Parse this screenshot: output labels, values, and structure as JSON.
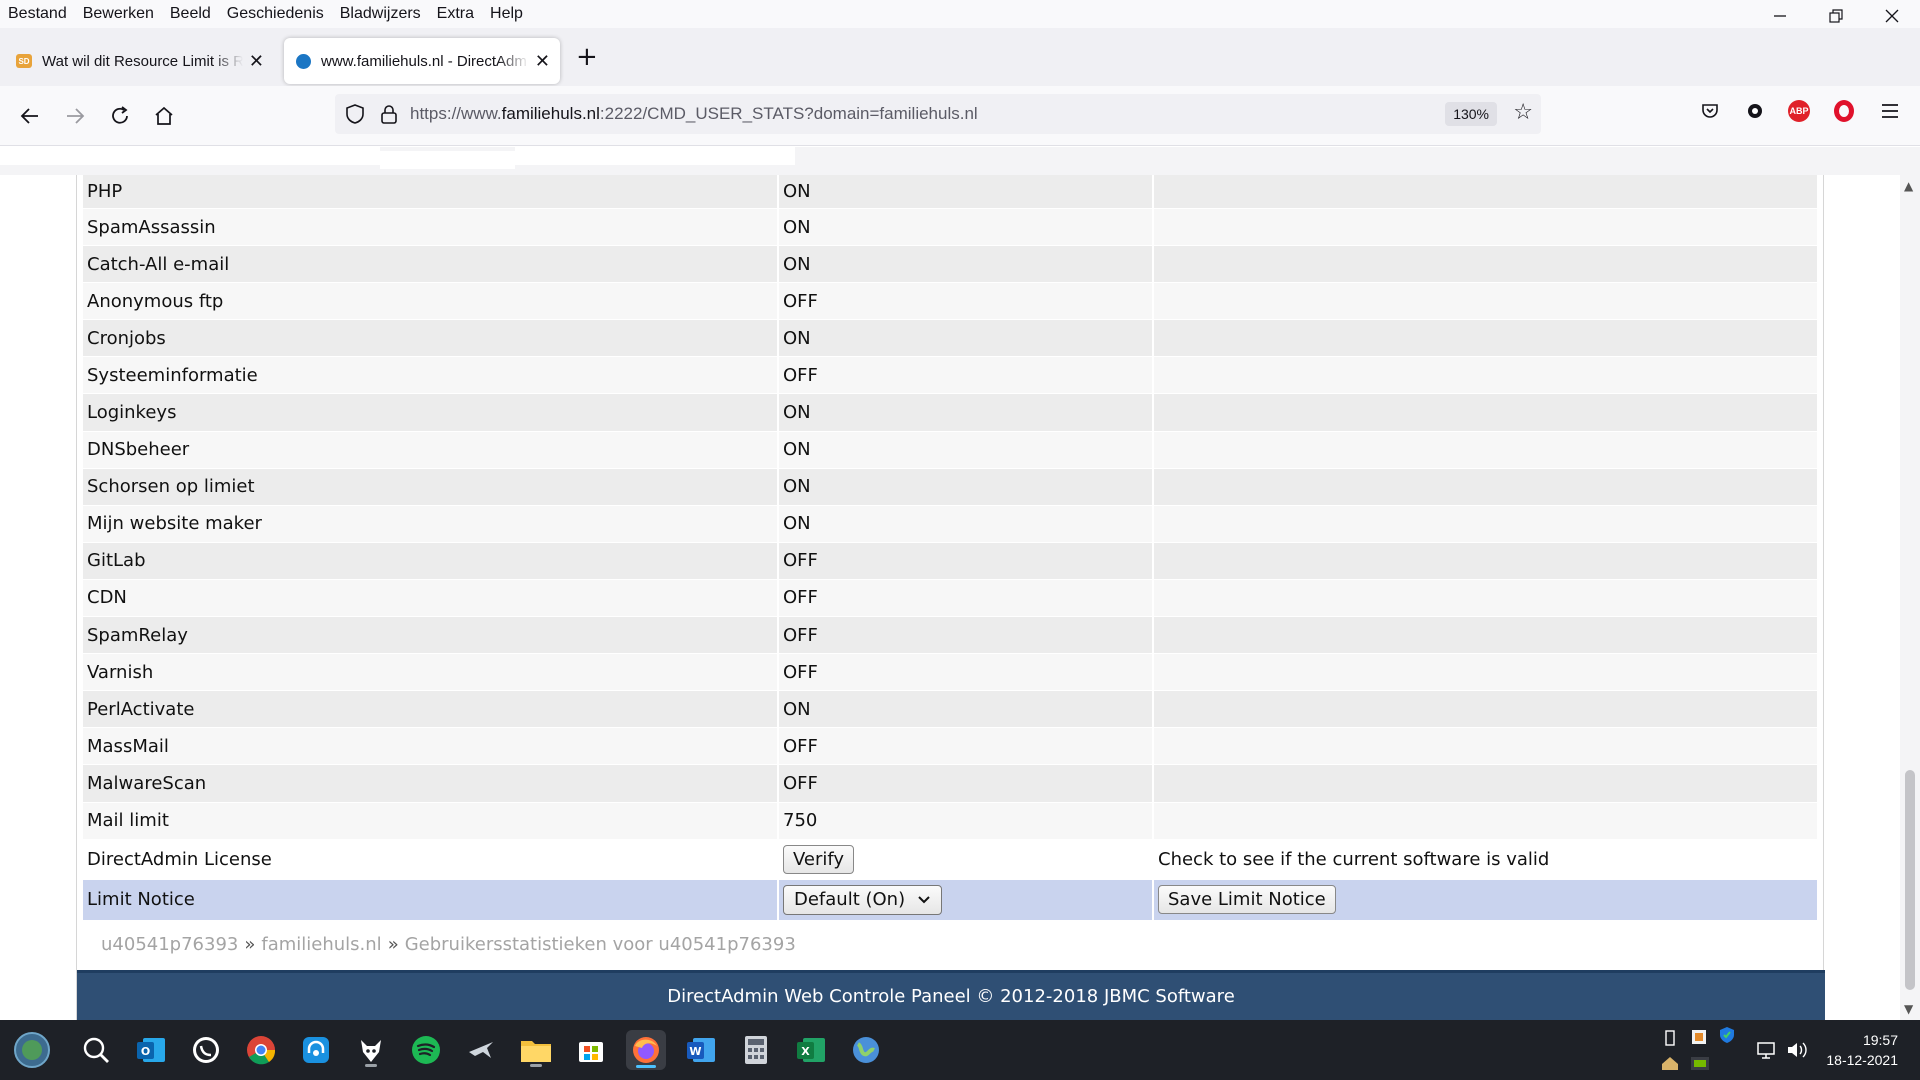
{
  "menubar": {
    "items": [
      "Bestand",
      "Bewerken",
      "Beeld",
      "Geschiedenis",
      "Bladwijzers",
      "Extra",
      "Help"
    ]
  },
  "tabs": [
    {
      "title": "Wat wil dit Resource Limit is Re",
      "favicon": "sd-favicon",
      "active": false
    },
    {
      "title": "www.familiehuls.nl - DirectAdm",
      "favicon": "globe-favicon",
      "active": true
    }
  ],
  "urlbar": {
    "url_prefix": "https://www.",
    "url_domain": "familiehuls.nl",
    "url_suffix": ":2222/CMD_USER_STATS?domain=familiehuls.nl",
    "zoom": "130%"
  },
  "table": {
    "rows": [
      {
        "label": "PHP",
        "value": "ON"
      },
      {
        "label": "SpamAssassin",
        "value": "ON"
      },
      {
        "label": "Catch-All e-mail",
        "value": "ON"
      },
      {
        "label": "Anonymous ftp",
        "value": "OFF"
      },
      {
        "label": "Cronjobs",
        "value": "ON"
      },
      {
        "label": "Systeeminformatie",
        "value": "OFF"
      },
      {
        "label": "Loginkeys",
        "value": "ON"
      },
      {
        "label": "DNSbeheer",
        "value": "ON"
      },
      {
        "label": "Schorsen op limiet",
        "value": "ON"
      },
      {
        "label": "Mijn website maker",
        "value": "ON"
      },
      {
        "label": "GitLab",
        "value": "OFF"
      },
      {
        "label": "CDN",
        "value": "OFF"
      },
      {
        "label": "SpamRelay",
        "value": "OFF"
      },
      {
        "label": "Varnish",
        "value": "OFF"
      },
      {
        "label": "PerlActivate",
        "value": "ON"
      },
      {
        "label": "MassMail",
        "value": "OFF"
      },
      {
        "label": "MalwareScan",
        "value": "OFF"
      },
      {
        "label": "Mail limit",
        "value": "750"
      }
    ],
    "license": {
      "label": "DirectAdmin License",
      "button": "Verify",
      "description": "Check to see if the current software is valid"
    },
    "notice": {
      "label": "Limit Notice",
      "select_value": "Default (On)",
      "button": "Save Limit Notice"
    }
  },
  "breadcrumb": {
    "user": "u40541p76393",
    "domain": "familiehuls.nl",
    "page": "Gebruikersstatistieken voor u40541p76393",
    "separator": "»"
  },
  "footer": {
    "text": "DirectAdmin Web Controle Paneel © 2012-2018 JBMC Software"
  },
  "clock": {
    "time": "19:57",
    "date": "18-12-2021"
  },
  "colors": {
    "footer_bg": "#2f4f74",
    "notice_row_bg": "#c9d3ee",
    "taskbar_bg": "#1e2127"
  }
}
